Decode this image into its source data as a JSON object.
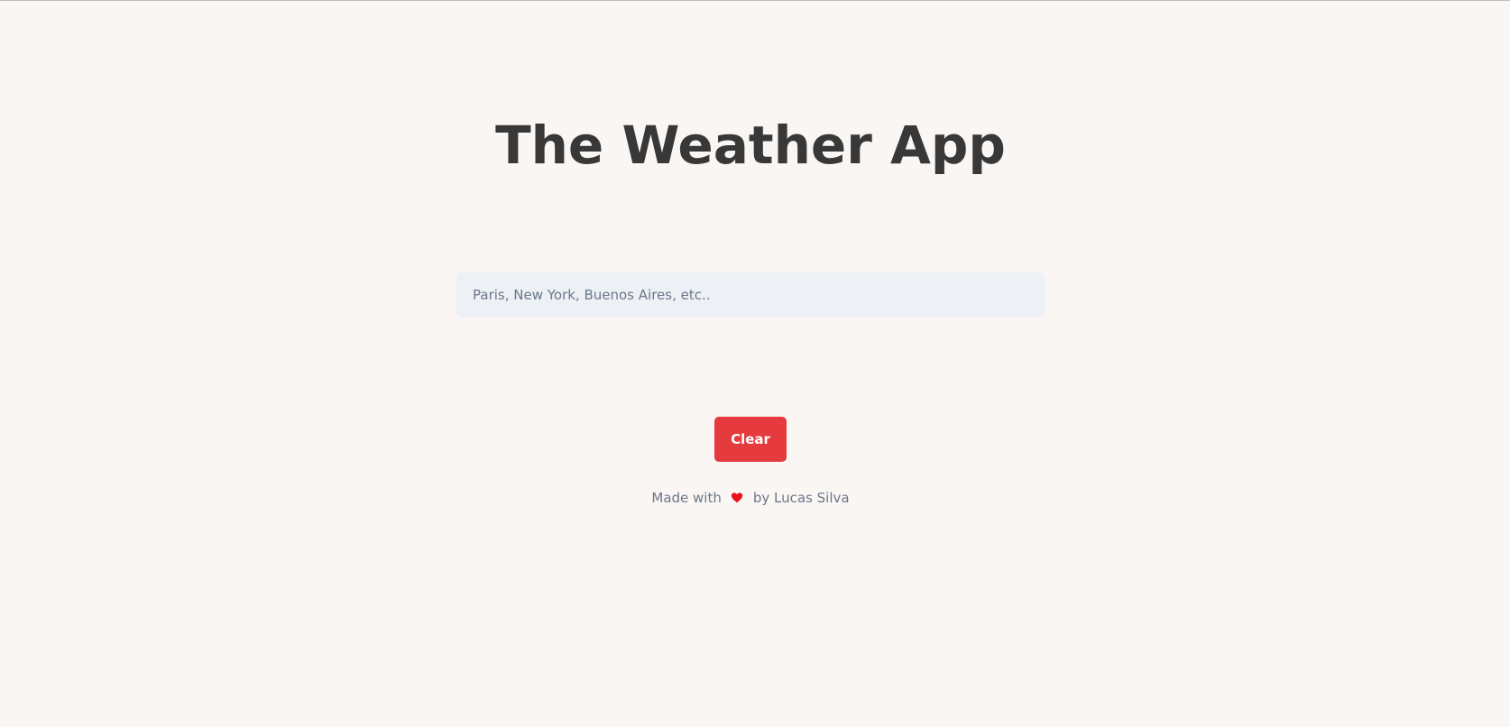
{
  "app": {
    "title": "The Weather App"
  },
  "search": {
    "placeholder": "Paris, New York, Buenos Aires, etc..",
    "value": ""
  },
  "actions": {
    "clear_label": "Clear"
  },
  "footer": {
    "prefix": "Made with",
    "icon": "heart-icon",
    "suffix": "by Lucas Silva"
  },
  "colors": {
    "background": "#faf6f3",
    "title": "#383838",
    "input_background": "#edf1f6",
    "clear_button": "#e53a3e",
    "heart": "#e8141c",
    "muted_text": "#6b778a"
  }
}
